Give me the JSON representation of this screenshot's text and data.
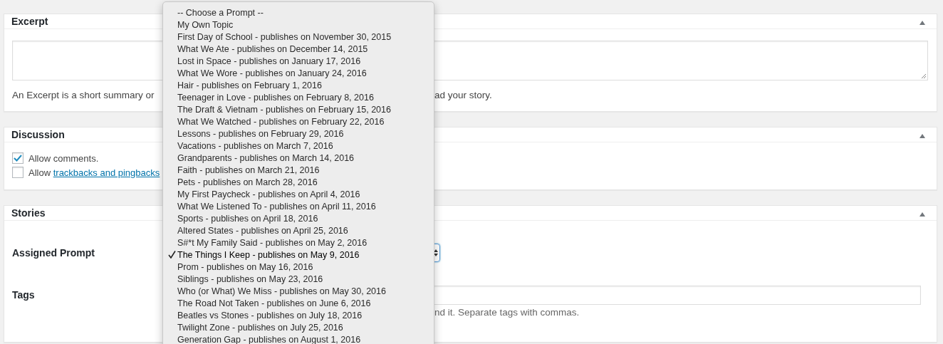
{
  "excerpt": {
    "title": "Excerpt",
    "help_left": "An Excerpt is a short summary or",
    "help_right": "ad your story."
  },
  "discussion": {
    "title": "Discussion",
    "options": [
      {
        "label": "Allow comments.",
        "checked": true
      },
      {
        "label": "Allow ",
        "link": "trackbacks and pingbacks",
        "checked": false
      }
    ]
  },
  "stories": {
    "title": "Stories",
    "prompt_label": "Assigned Prompt",
    "tags_label": "Tags",
    "tags_help": "nd it. Separate tags with commas."
  },
  "prompt_menu": [
    {
      "label": "-- Choose a Prompt --",
      "selected": false
    },
    {
      "label": "My Own Topic",
      "selected": false
    },
    {
      "label": "First Day of School - publishes on November 30, 2015",
      "selected": false
    },
    {
      "label": "What We Ate - publishes on December 14, 2015",
      "selected": false
    },
    {
      "label": "Lost in Space - publishes on January 17, 2016",
      "selected": false
    },
    {
      "label": "What We Wore - publishes on January 24, 2016",
      "selected": false
    },
    {
      "label": "Hair - publishes on February 1, 2016",
      "selected": false
    },
    {
      "label": "Teenager in Love - publishes on February 8, 2016",
      "selected": false
    },
    {
      "label": "The Draft & Vietnam - publishes on February 15, 2016",
      "selected": false
    },
    {
      "label": "What We Watched - publishes on February 22, 2016",
      "selected": false
    },
    {
      "label": "Lessons - publishes on February 29, 2016",
      "selected": false
    },
    {
      "label": "Vacations - publishes on March 7, 2016",
      "selected": false
    },
    {
      "label": "Grandparents - publishes on March 14, 2016",
      "selected": false
    },
    {
      "label": "Faith - publishes on March 21, 2016",
      "selected": false
    },
    {
      "label": "Pets - publishes on March 28, 2016",
      "selected": false
    },
    {
      "label": "My First Paycheck - publishes on April 4, 2016",
      "selected": false
    },
    {
      "label": "What We Listened To - publishes on April 11, 2016",
      "selected": false
    },
    {
      "label": "Sports - publishes on April 18, 2016",
      "selected": false
    },
    {
      "label": "Altered States - publishes on April 25, 2016",
      "selected": false
    },
    {
      "label": "S#*t My Family Said - publishes on May 2, 2016",
      "selected": false
    },
    {
      "label": "The Things I Keep - publishes on May 9, 2016",
      "selected": true
    },
    {
      "label": "Prom - publishes on May 16, 2016",
      "selected": false
    },
    {
      "label": "Siblings - publishes on May 23, 2016",
      "selected": false
    },
    {
      "label": "Who (or What) We Miss - publishes on May 30, 2016",
      "selected": false
    },
    {
      "label": "The Road Not Taken - publishes on June 6, 2016",
      "selected": false
    },
    {
      "label": "Beatles vs Stones - publishes on July 18, 2016",
      "selected": false
    },
    {
      "label": "Twilight Zone - publishes on July 25, 2016",
      "selected": false
    },
    {
      "label": "Generation Gap - publishes on August 1, 2016",
      "selected": false
    }
  ]
}
